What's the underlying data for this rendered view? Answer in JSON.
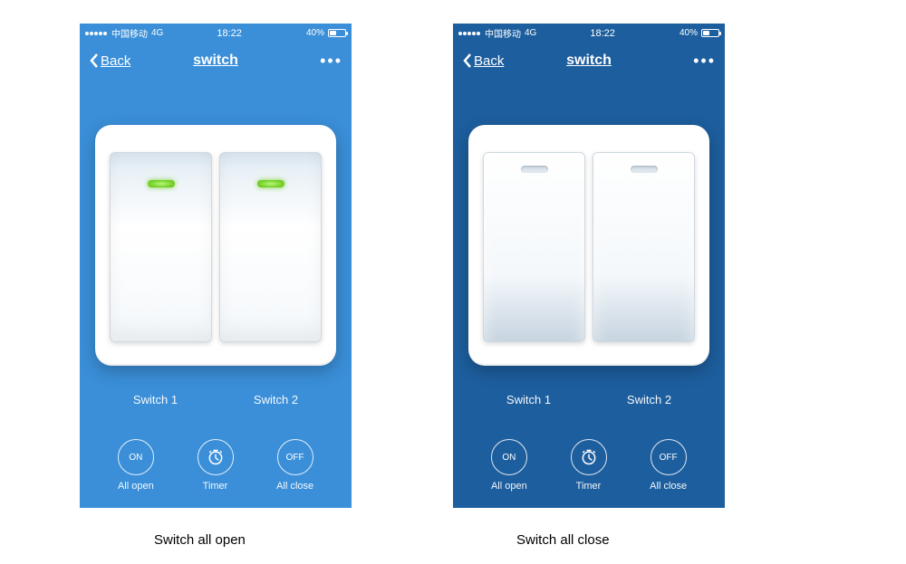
{
  "statusbar": {
    "carrier": "中国移动",
    "network": "4G",
    "time": "18:22",
    "battery_pct": "40%",
    "battery_fill_pct": 40
  },
  "nav": {
    "back": "Back",
    "title": "switch",
    "more": "•••"
  },
  "switches": {
    "items": [
      {
        "label": "Switch 1"
      },
      {
        "label": "Switch 2"
      }
    ]
  },
  "actions": {
    "on": {
      "icon": "ON",
      "label": "All open"
    },
    "timer": {
      "label": "Timer"
    },
    "off": {
      "icon": "OFF",
      "label": "All close"
    }
  },
  "captions": {
    "left": "Switch all open",
    "right": "Switch all close"
  }
}
